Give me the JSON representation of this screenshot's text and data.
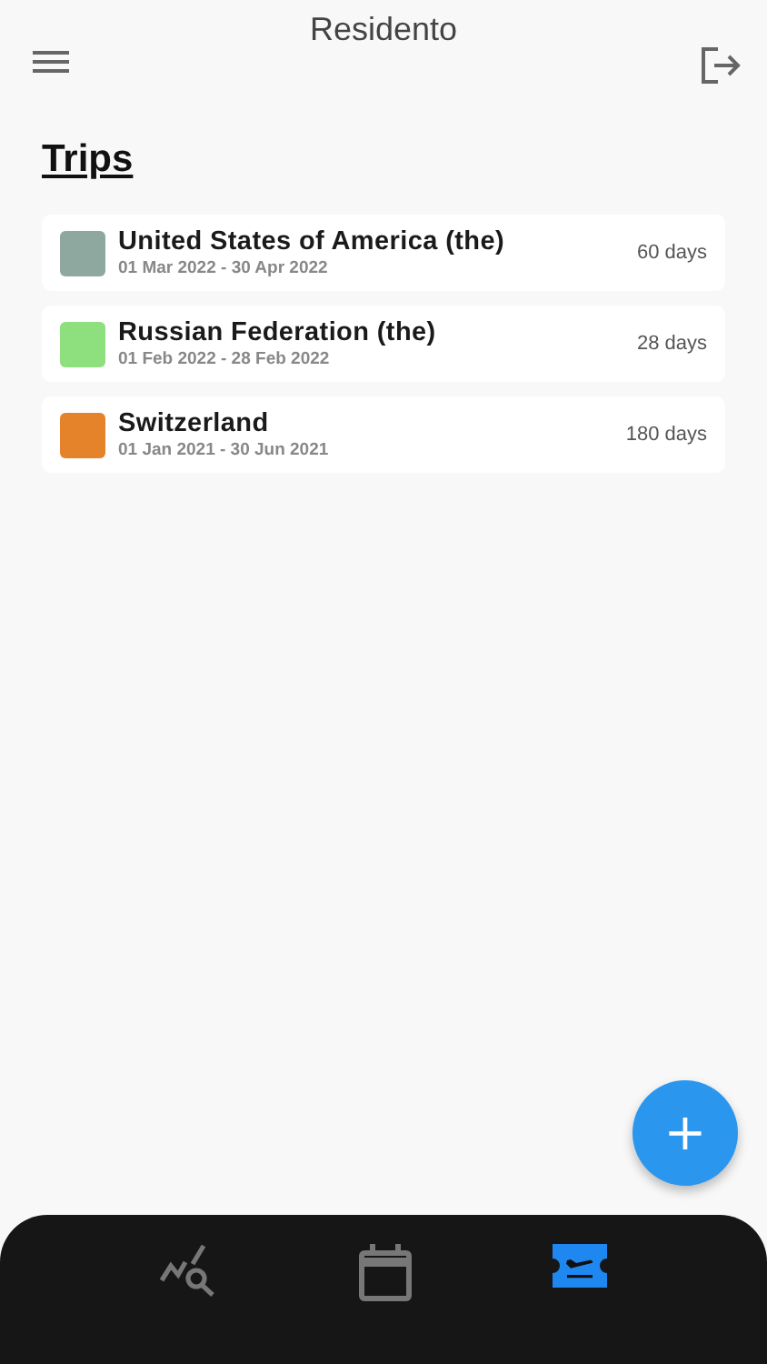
{
  "app_bar": {
    "title": "Residento"
  },
  "heading": "Trips",
  "trips": [
    {
      "country": "United States of America (the)",
      "dates": "01 Mar 2022 - 30 Apr 2022",
      "duration": "60 days",
      "color": "#8fa89f"
    },
    {
      "country": "Russian Federation (the)",
      "dates": "01 Feb 2022 - 28 Feb 2022",
      "duration": "28 days",
      "color": "#8ee07e"
    },
    {
      "country": "Switzerland",
      "dates": "01 Jan 2021 - 30 Jun 2021",
      "duration": "180 days",
      "color": "#e4832a"
    }
  ],
  "fab": {
    "label": "+"
  },
  "nav": [
    {
      "kind": "analytics",
      "selected": false
    },
    {
      "kind": "calendar",
      "selected": false
    },
    {
      "kind": "flight",
      "selected": true
    }
  ]
}
